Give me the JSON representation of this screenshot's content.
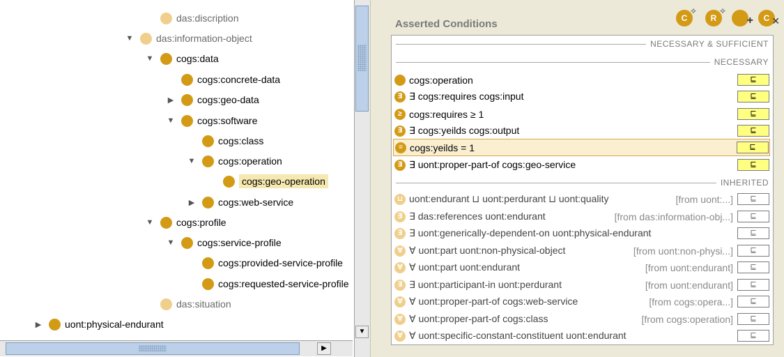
{
  "tree": {
    "items": [
      {
        "label": "das:discription",
        "indent": 4,
        "arrow": "",
        "faded": true
      },
      {
        "label": "das:information-object",
        "indent": 3,
        "arrow": "▼",
        "faded": true
      },
      {
        "label": "cogs:data",
        "indent": 4,
        "arrow": "▼",
        "faded": false
      },
      {
        "label": "cogs:concrete-data",
        "indent": 5,
        "arrow": "",
        "faded": false
      },
      {
        "label": "cogs:geo-data",
        "indent": 5,
        "arrow": "▶",
        "faded": false
      },
      {
        "label": "cogs:software",
        "indent": 5,
        "arrow": "▼",
        "faded": false
      },
      {
        "label": "cogs:class",
        "indent": 6,
        "arrow": "",
        "faded": false
      },
      {
        "label": "cogs:operation",
        "indent": 6,
        "arrow": "▼",
        "faded": false
      },
      {
        "label": "cogs:geo-operation",
        "indent": 7,
        "arrow": "",
        "faded": false,
        "selected": true
      },
      {
        "label": "cogs:web-service",
        "indent": 6,
        "arrow": "▶",
        "faded": false
      },
      {
        "label": "cogs:profile",
        "indent": 4,
        "arrow": "▼",
        "faded": false
      },
      {
        "label": "cogs:service-profile",
        "indent": 5,
        "arrow": "▼",
        "faded": false
      },
      {
        "label": "cogs:provided-service-profile",
        "indent": 6,
        "arrow": "",
        "faded": false
      },
      {
        "label": "cogs:requested-service-profile",
        "indent": 6,
        "arrow": "",
        "faded": false
      },
      {
        "label": "das:situation",
        "indent": 4,
        "arrow": "",
        "faded": true
      },
      {
        "label": "uont:physical-endurant",
        "indent": 1,
        "arrow": "▶",
        "faded": false
      }
    ]
  },
  "conditions": {
    "title": "Asserted Conditions",
    "toolbar_icons": [
      "add-named-class-icon",
      "add-restriction-icon",
      "add-condition-icon",
      "delete-condition-icon"
    ],
    "headers": {
      "nec_suff": "NECESSARY & SUFFICIENT",
      "necessary": "NECESSARY",
      "inherited": "INHERITED"
    },
    "subclass_symbol": "⊑",
    "necessary": [
      {
        "icon": "",
        "text": "cogs:operation",
        "from": "",
        "type": "class"
      },
      {
        "icon": "∃",
        "text": "∃ cogs:requires cogs:input",
        "from": "",
        "type": "restriction"
      },
      {
        "icon": "≥",
        "text": "cogs:requires ≥ 1",
        "from": "",
        "type": "restriction"
      },
      {
        "icon": "∃",
        "text": "∃ cogs:yeilds cogs:output",
        "from": "",
        "type": "restriction"
      },
      {
        "icon": "=",
        "text": "cogs:yeilds = 1",
        "from": "",
        "type": "restriction",
        "selected": true
      },
      {
        "icon": "∃",
        "text": "∃ uont:proper-part-of cogs:geo-service",
        "from": "",
        "type": "restriction"
      }
    ],
    "inherited": [
      {
        "icon": "⊔",
        "text": "uont:endurant ⊔ uont:perdurant ⊔ uont:quality",
        "from": "[from uont:...]"
      },
      {
        "icon": "∃",
        "text": "∃ das:references uont:endurant",
        "from": "[from das:information-obj...]"
      },
      {
        "icon": "∃",
        "text": "∃ uont:generically-dependent-on uont:physical-endurant",
        "from": ""
      },
      {
        "icon": "∀",
        "text": "∀ uont:part uont:non-physical-object",
        "from": "[from uont:non-physi...]"
      },
      {
        "icon": "∀",
        "text": "∀ uont:part uont:endurant",
        "from": "[from uont:endurant]"
      },
      {
        "icon": "∃",
        "text": "∃ uont:participant-in uont:perdurant",
        "from": "[from uont:endurant]"
      },
      {
        "icon": "∀",
        "text": "∀ uont:proper-part-of cogs:web-service",
        "from": "[from cogs:opera...]"
      },
      {
        "icon": "∀",
        "text": "∀ uont:proper-part-of cogs:class",
        "from": "[from cogs:operation]"
      },
      {
        "icon": "∀",
        "text": "∀ uont:specific-constant-constituent uont:endurant",
        "from": ""
      }
    ]
  },
  "colors": {
    "class_dot": "#d39a16",
    "faded_dot": "#f0cf8c",
    "subclass_btn": "#ffff80"
  }
}
